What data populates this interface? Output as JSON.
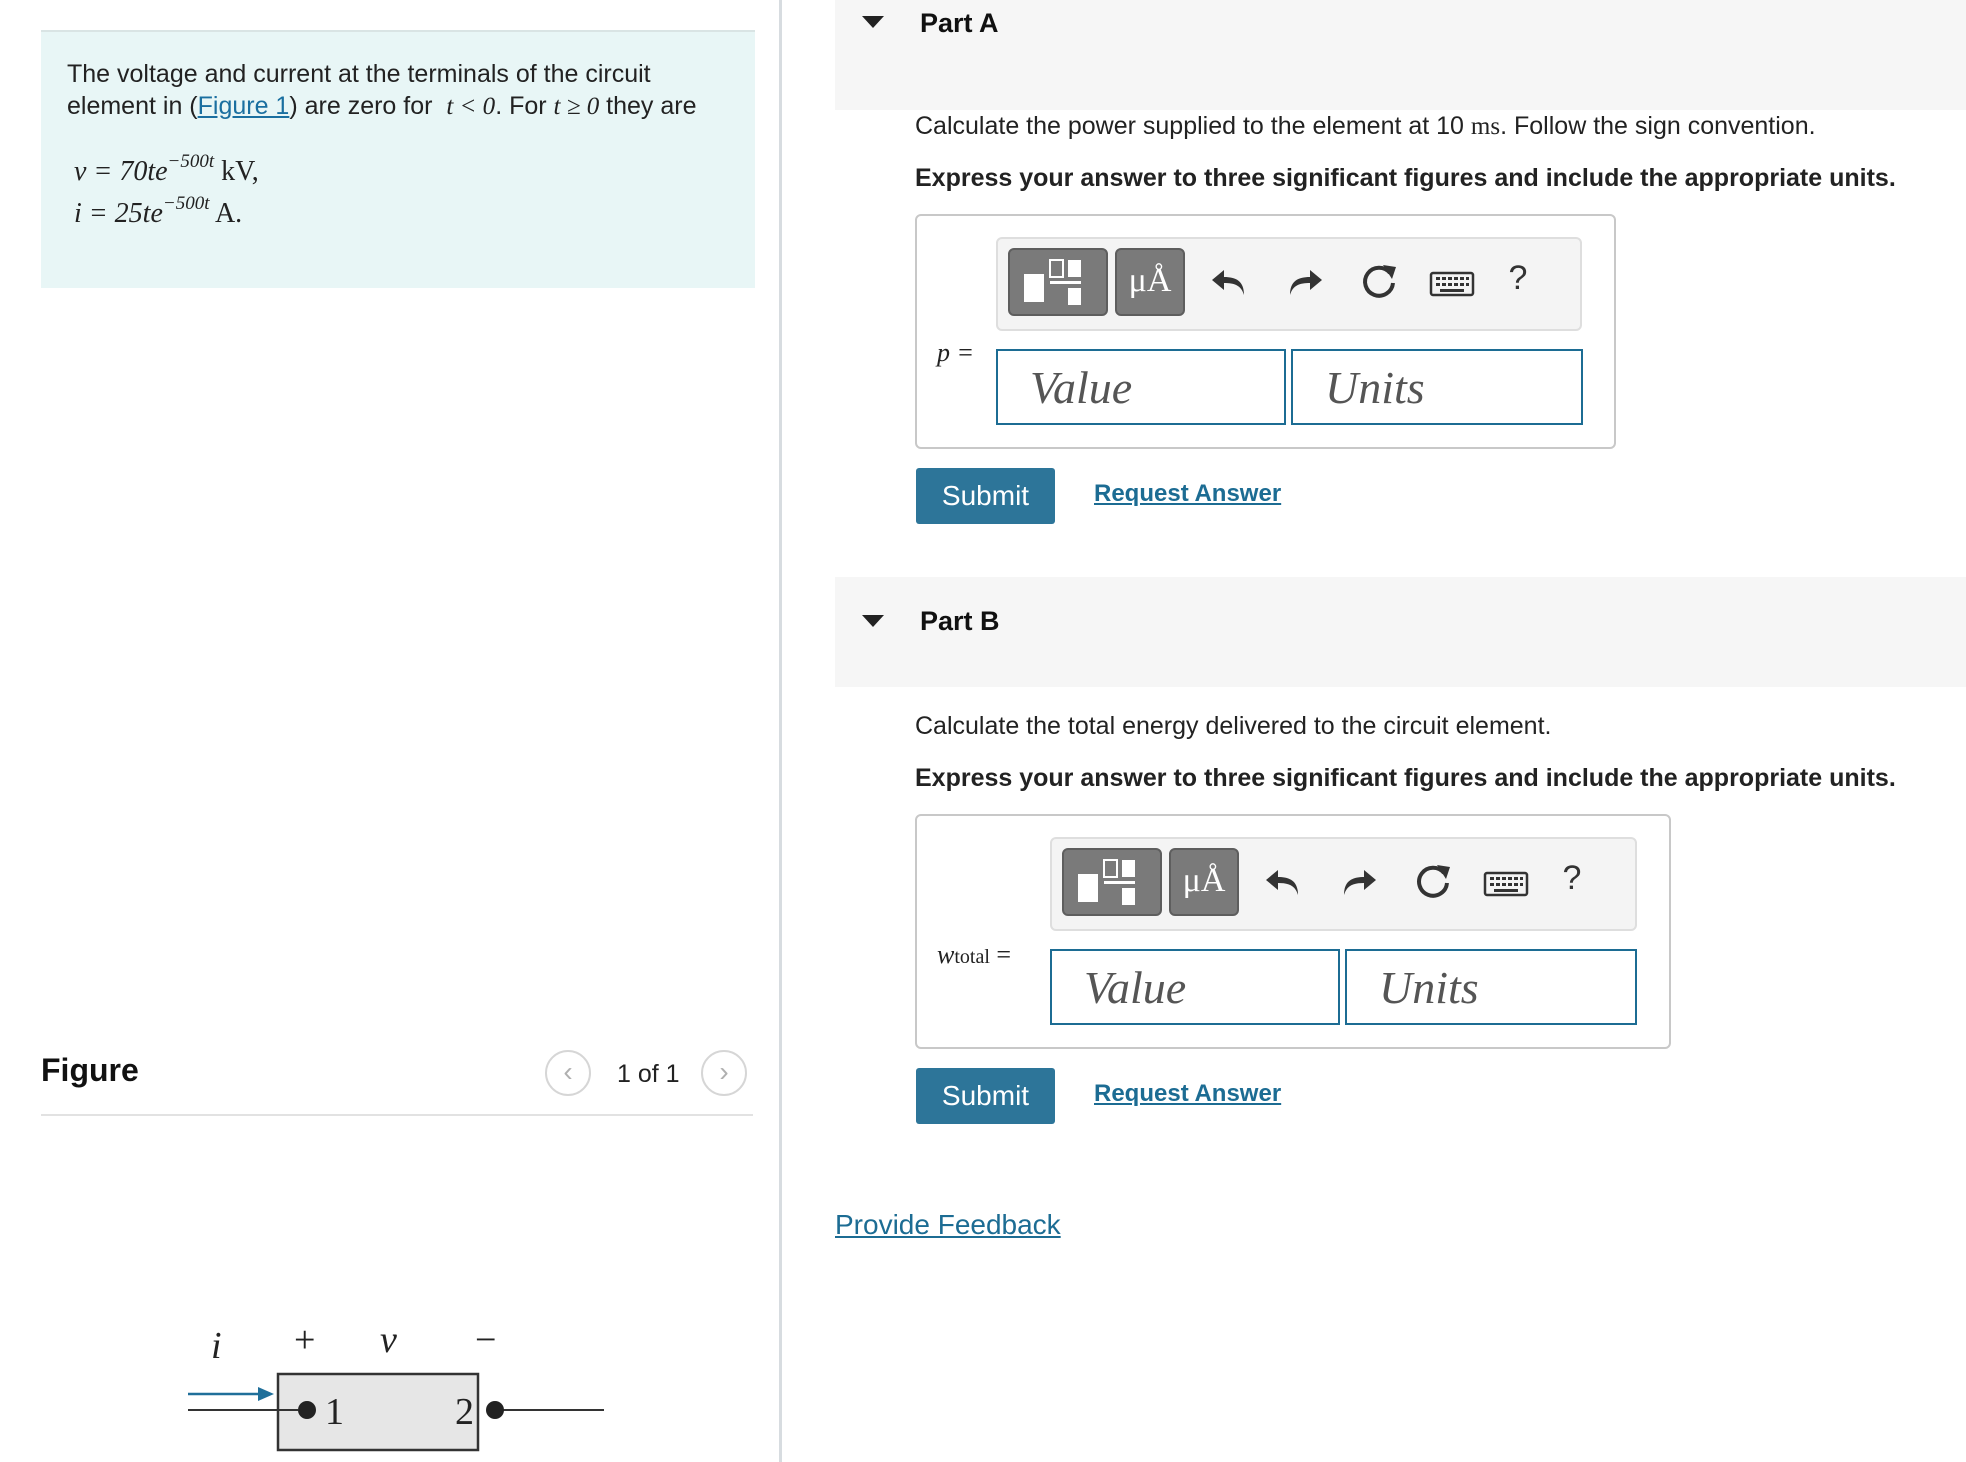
{
  "problem": {
    "text_before_link": "The voltage and current at the terminals of the circuit element in (",
    "figure_link": "Figure 1",
    "text_after_link": ") are zero for",
    "cond1": "t < 0",
    "text_for": ". For",
    "cond2": "t ≥ 0",
    "text_they_are": " they are",
    "eq_v_lhs": "v = 70te",
    "eq_v_exp": "−500t",
    "eq_v_unit": " kV,",
    "eq_i_lhs": "i = 25te",
    "eq_i_exp": "−500t",
    "eq_i_unit": " A."
  },
  "figure": {
    "title": "Figure",
    "pager_text": "1 of 1",
    "prev_glyph": "‹",
    "next_glyph": "›",
    "circuit": {
      "current_label": "i",
      "plus": "+",
      "voltage_label": "v",
      "minus": "−",
      "terminal1": "1",
      "terminal2": "2"
    }
  },
  "partA": {
    "title": "Part A",
    "question_before": "Calculate the power supplied to the element at 10 ",
    "question_unit": "ms",
    "question_after": ". Follow the sign convention.",
    "instruction": "Express your answer to three significant figures and include the appropriate units.",
    "var_label": "p =",
    "value_placeholder": "Value",
    "units_placeholder": "Units",
    "submit": "Submit",
    "request": "Request Answer"
  },
  "partB": {
    "title": "Part B",
    "question": "Calculate the total energy delivered to the circuit element.",
    "instruction": "Express your answer to three significant figures and include the appropriate units.",
    "var_main": "w",
    "var_sub": "total",
    "var_eq": " =",
    "value_placeholder": "Value",
    "units_placeholder": "Units",
    "submit": "Submit",
    "request": "Request Answer"
  },
  "toolbar": {
    "units_button": "μÅ",
    "help": "?"
  },
  "feedback": "Provide Feedback",
  "colors": {
    "accent": "#1c6c93",
    "submit_bg": "#2d7599",
    "problem_bg": "#e8f6f6"
  }
}
